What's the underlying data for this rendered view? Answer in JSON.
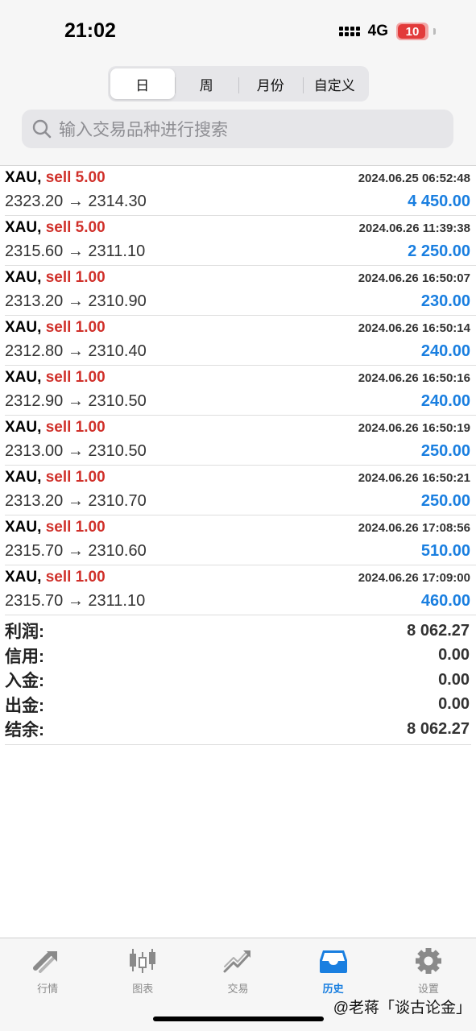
{
  "status_bar": {
    "time": "21:02",
    "network": "4G",
    "battery": "10"
  },
  "segments": [
    "日",
    "周",
    "月份",
    "自定义"
  ],
  "active_segment": 0,
  "search": {
    "placeholder": "输入交易品种进行搜索"
  },
  "trades": [
    {
      "symbol": "XAU,",
      "side": "sell 5.00",
      "time": "2024.06.25 06:52:48",
      "prices": "2323.20 → 2314.30",
      "profit": "4 450.00"
    },
    {
      "symbol": "XAU,",
      "side": "sell 5.00",
      "time": "2024.06.26 11:39:38",
      "prices": "2315.60 → 2311.10",
      "profit": "2 250.00"
    },
    {
      "symbol": "XAU,",
      "side": "sell 1.00",
      "time": "2024.06.26 16:50:07",
      "prices": "2313.20 → 2310.90",
      "profit": "230.00"
    },
    {
      "symbol": "XAU,",
      "side": "sell 1.00",
      "time": "2024.06.26 16:50:14",
      "prices": "2312.80 → 2310.40",
      "profit": "240.00"
    },
    {
      "symbol": "XAU,",
      "side": "sell 1.00",
      "time": "2024.06.26 16:50:16",
      "prices": "2312.90 → 2310.50",
      "profit": "240.00"
    },
    {
      "symbol": "XAU,",
      "side": "sell 1.00",
      "time": "2024.06.26 16:50:19",
      "prices": "2313.00 → 2310.50",
      "profit": "250.00"
    },
    {
      "symbol": "XAU,",
      "side": "sell 1.00",
      "time": "2024.06.26 16:50:21",
      "prices": "2313.20 → 2310.70",
      "profit": "250.00"
    },
    {
      "symbol": "XAU,",
      "side": "sell 1.00",
      "time": "2024.06.26 17:08:56",
      "prices": "2315.70 → 2310.60",
      "profit": "510.00"
    },
    {
      "symbol": "XAU,",
      "side": "sell 1.00",
      "time": "2024.06.26 17:09:00",
      "prices": "2315.70 → 2311.10",
      "profit": "460.00"
    }
  ],
  "summary": [
    {
      "label": "利润:",
      "value": "8 062.27"
    },
    {
      "label": "信用:",
      "value": "0.00"
    },
    {
      "label": "入金:",
      "value": "0.00"
    },
    {
      "label": "出金:",
      "value": "0.00"
    },
    {
      "label": "结余:",
      "value": "8 062.27"
    }
  ],
  "tabs": [
    {
      "label": "行情",
      "icon": "quotes-icon"
    },
    {
      "label": "图表",
      "icon": "chart-icon"
    },
    {
      "label": "交易",
      "icon": "trade-icon"
    },
    {
      "label": "历史",
      "icon": "history-icon"
    },
    {
      "label": "设置",
      "icon": "settings-icon"
    }
  ],
  "active_tab": 3,
  "watermark": "@老蒋「谈古论金」",
  "colors": {
    "sell": "#d0302a",
    "profit": "#1a7fe0",
    "active_tab": "#1a7fe0"
  }
}
